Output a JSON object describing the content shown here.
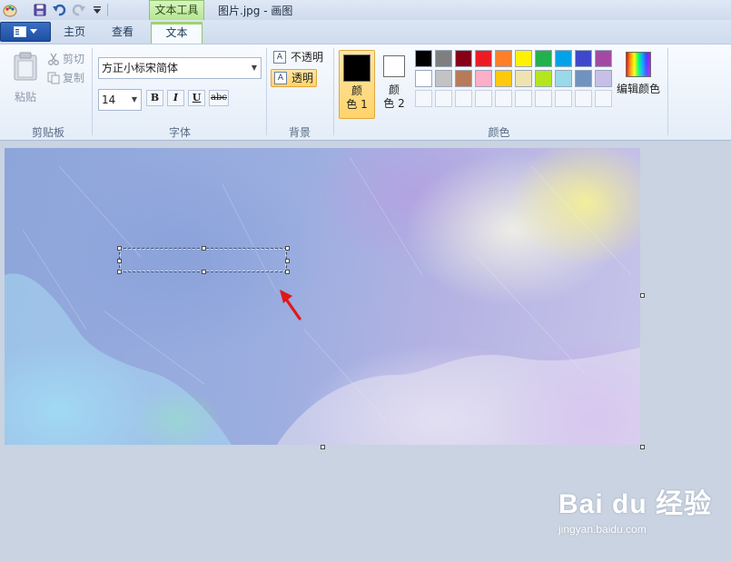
{
  "window": {
    "title": "图片.jpg - 画图",
    "context_tab_label": "文本工具"
  },
  "tabs": {
    "home": "主页",
    "view": "查看",
    "text": "文本"
  },
  "ribbon": {
    "clipboard": {
      "paste": "粘贴",
      "cut": "剪切",
      "copy": "复制",
      "group_label": "剪贴板"
    },
    "font": {
      "family": "方正小标宋简体",
      "size": "14",
      "bold": "B",
      "italic": "I",
      "underline": "U",
      "strikethrough": "abc",
      "group_label": "字体"
    },
    "background": {
      "opaque": "不透明",
      "transparent": "透明",
      "selected": "透明",
      "group_label": "背景"
    },
    "colors": {
      "color1_label_a": "颜",
      "color1_label_b": "色 1",
      "color2_label_a": "颜",
      "color2_label_b": "色 2",
      "color1_value": "#000000",
      "color2_value": "#ffffff",
      "edit_colors": "编辑颜色",
      "group_label": "颜色",
      "palette": [
        "#000000",
        "#7f7f7f",
        "#880015",
        "#ed1c24",
        "#ff7f27",
        "#fff200",
        "#22b14c",
        "#00a2e8",
        "#3f48cc",
        "#a349a4",
        "#ffffff",
        "#c3c3c3",
        "#b97a57",
        "#ffaec9",
        "#ffc90e",
        "#efe4b0",
        "#b5e61d",
        "#99d9ea",
        "#7092be",
        "#c8bfe7",
        "",
        "",
        "",
        "",
        "",
        "",
        "",
        "",
        "",
        ""
      ]
    }
  },
  "watermark": {
    "brand": "Bai du 经验",
    "site": "jingyan.baidu.com"
  }
}
